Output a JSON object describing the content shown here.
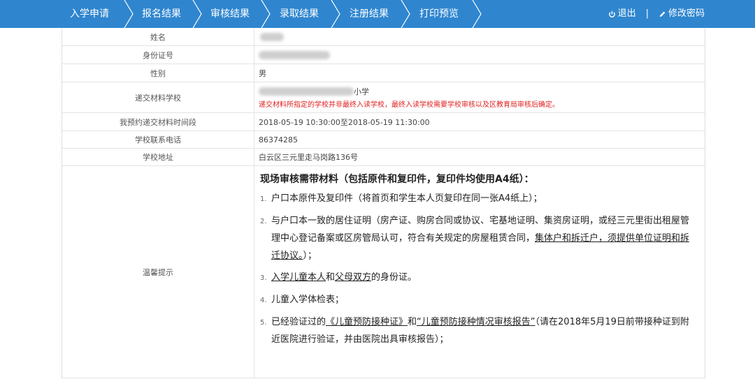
{
  "nav": {
    "steps": [
      "入学申请",
      "报名结果",
      "审核结果",
      "录取结果",
      "注册结果",
      "打印预览"
    ],
    "logout": "退出",
    "separator": "|",
    "change_password": "修改密码"
  },
  "rows": {
    "name": {
      "label": "姓名"
    },
    "id_number": {
      "label": "身份证号"
    },
    "gender": {
      "label": "性别",
      "value": "男"
    },
    "school": {
      "label": "递交材料学校",
      "suffix": "小学",
      "notice": "递交材料所指定的学校并非最终入读学校，最终入读学校需要学校审核以及区教育局审核后确定。"
    },
    "appointment": {
      "label": "我预约递交材料时间段",
      "value": "2018-05-19 10:30:00至2018-05-19 11:30:00"
    },
    "phone": {
      "label": "学校联系电话",
      "value": "86374285"
    },
    "address": {
      "label": "学校地址",
      "value": "白云区三元里走马岗路136号"
    },
    "tips": {
      "label": "温馨提示",
      "title": "现场审核需带材料（包括原件和复印件，复印件均使用A4纸）：",
      "items": [
        {
          "num": "1.",
          "text": "户口本原件及复印件（将首页和学生本人页复印在同一张A4纸上）；"
        },
        {
          "num": "2.",
          "text_a": "与户口本一致的居住证明（房产证、购房合同或协议、宅基地证明、集资房证明，或经三元里街出租屋管理中心登记备案或区房管局认可，符合有关规定的房屋租赁合同，",
          "text_u": "集体户和拆迁户，须提供单位证明和拆迁协议。",
          "text_b": "）；"
        },
        {
          "num": "3.",
          "u1": "入学儿童本人",
          "mid": "和",
          "u2": "父母双方",
          "end": "的身份证。"
        },
        {
          "num": "4.",
          "text": "儿童入学体检表；"
        },
        {
          "num": "5.",
          "a": "已经验证过的",
          "u1": "《儿童预防接种证》",
          "mid": "和",
          "u2": "“儿童预防接种情况审核报告”",
          "end": "（请在2018年5月19日前带接种证到附近医院进行验证，并由医院出具审核报告）；"
        }
      ]
    }
  }
}
